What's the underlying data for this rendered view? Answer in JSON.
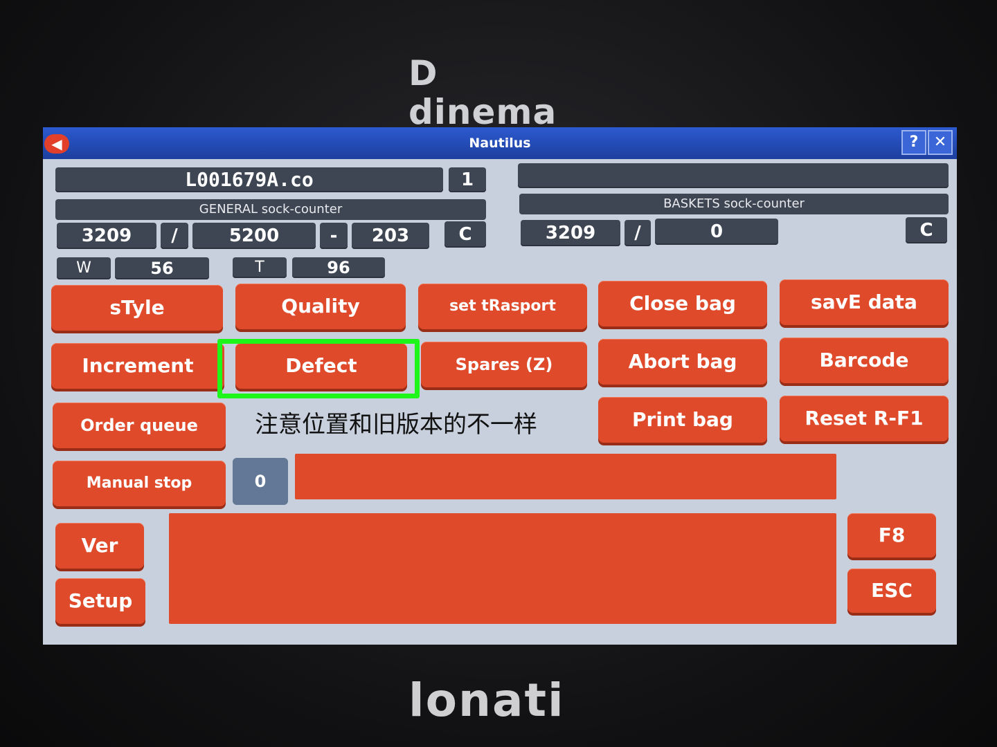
{
  "brand_top": "D dinema",
  "brand_bottom": "lonati",
  "window": {
    "title": "Nautilus",
    "help_label": "?",
    "close_label": "✕",
    "back_icon": "arrow-left-icon"
  },
  "file": {
    "name": "L001679A.co",
    "index": "1",
    "right_field": ""
  },
  "general_counter": {
    "caption": "GENERAL sock-counter",
    "current": "3209",
    "sep1": "/",
    "target": "5200",
    "sep2": "-",
    "remaining": "203",
    "clear": "C"
  },
  "baskets_counter": {
    "caption": "BASKETS sock-counter",
    "current": "3209",
    "sep": "/",
    "target": "0",
    "clear": "C"
  },
  "wt": {
    "w_label": "W",
    "w_value": "56",
    "t_label": "T",
    "t_value": "96"
  },
  "buttons": {
    "style": "sTyle",
    "quality": "Quality",
    "set_transport": "set tRasport",
    "close_bag": "Close bag",
    "save_data": "savE data",
    "increment": "Increment",
    "defect": "Defect",
    "spares": "Spares (Z)",
    "abort_bag": "Abort bag",
    "barcode": "Barcode",
    "order_queue": "Order queue",
    "print_bag": "Print bag",
    "reset": "Reset R-F1",
    "manual_stop": "Manual stop",
    "ver": "Ver",
    "setup": "Setup",
    "f8": "F8",
    "esc": "ESC"
  },
  "manual_stop_value": "0",
  "annotation": "注意位置和旧版本的不一样",
  "colors": {
    "button_red": "#df4a2b",
    "field_dark": "#3f4653",
    "screen_bg": "#c7d0dc",
    "title_blue": "#1d3f9e",
    "highlight_green": "#1ef61a"
  }
}
